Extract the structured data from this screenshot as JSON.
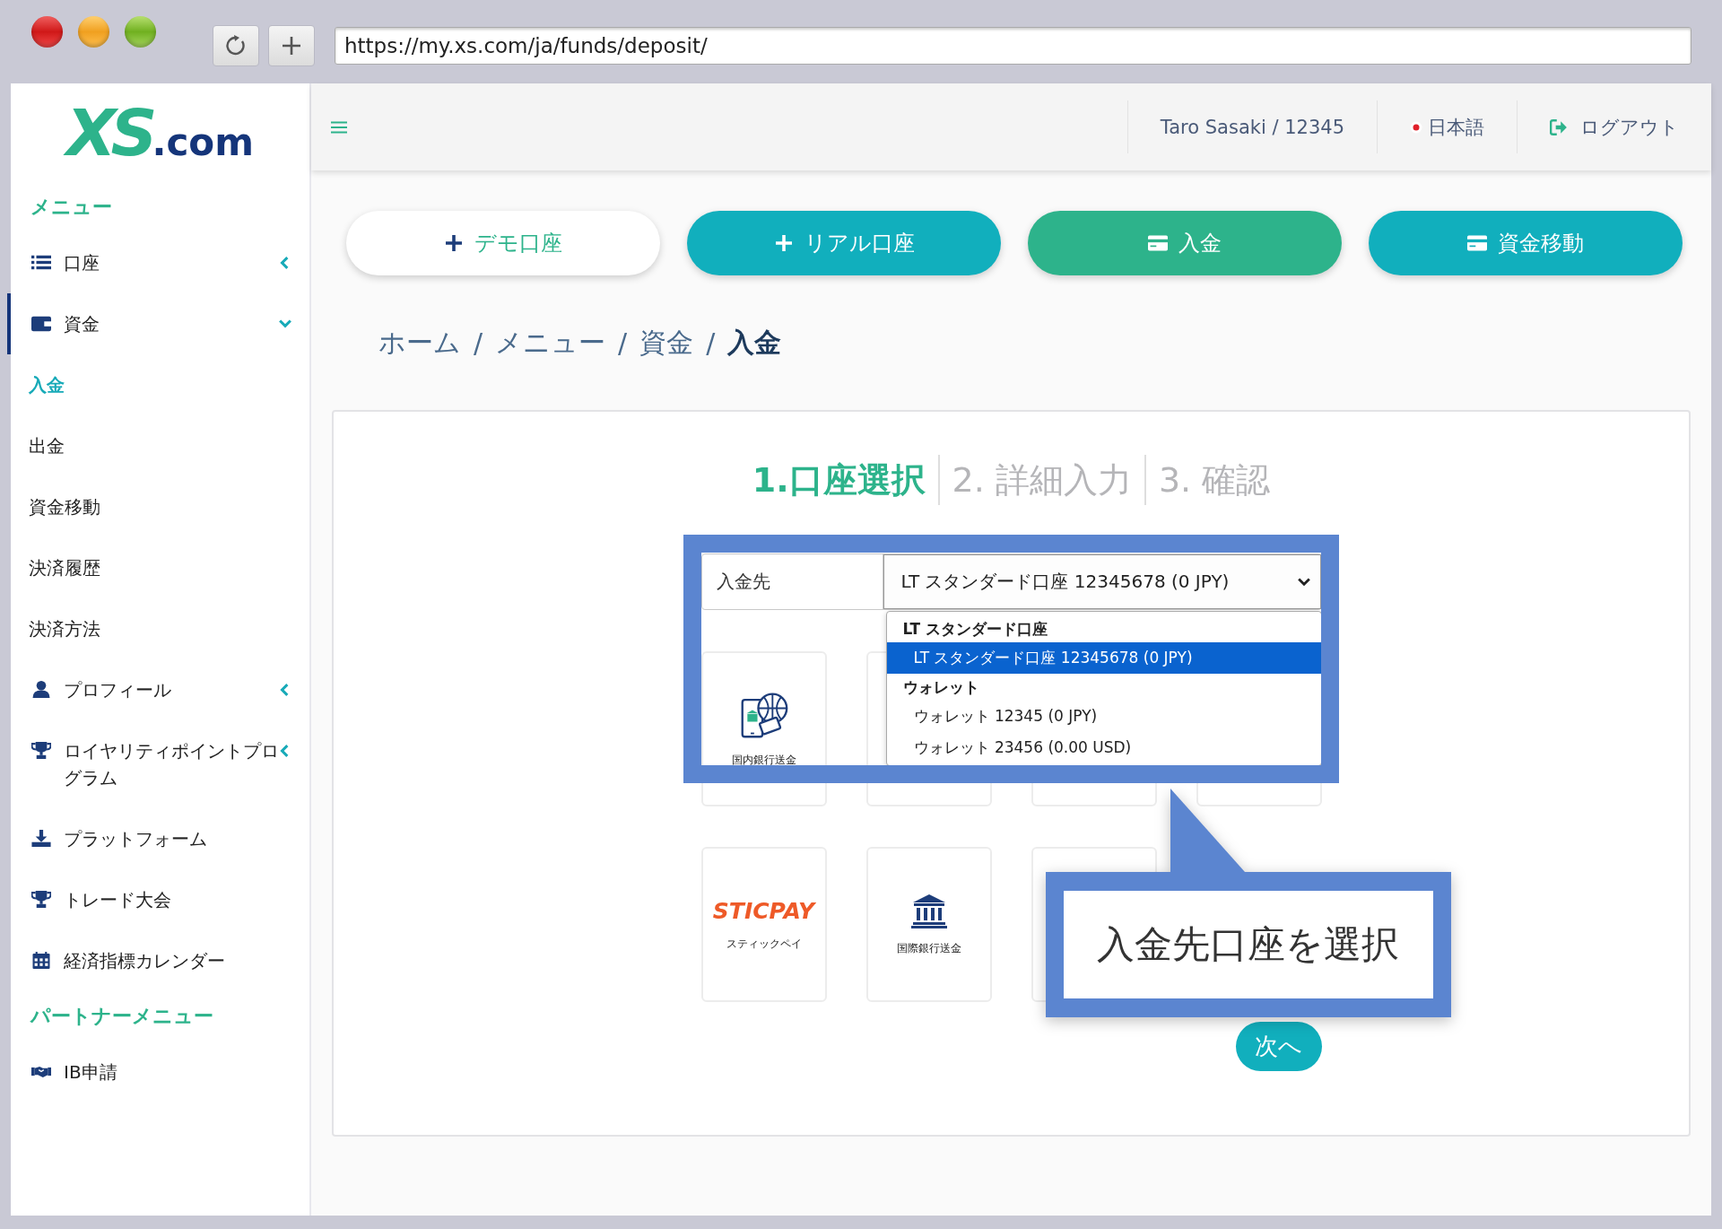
{
  "browser": {
    "url": "https://my.xs.com/ja/funds/deposit/"
  },
  "logo": {
    "mark": "XS",
    "suffix": ".com"
  },
  "sidebar": {
    "items": [
      {
        "kind": "heading",
        "label": "メニュー"
      },
      {
        "kind": "group",
        "label": "口座",
        "expanded": false,
        "selected": false
      },
      {
        "kind": "group",
        "label": "資金",
        "expanded": true,
        "selected": true,
        "children": [
          {
            "label": "入金",
            "selected": true
          },
          {
            "label": "出金",
            "selected": false
          },
          {
            "label": "資金移動",
            "selected": false
          },
          {
            "label": "決済履歴",
            "selected": false
          },
          {
            "label": "決済方法",
            "selected": false
          }
        ]
      },
      {
        "kind": "group",
        "label": "プロフィール",
        "expanded": false,
        "selected": false
      },
      {
        "kind": "group",
        "label": "ロイヤリティポイントプログラム",
        "expanded": false,
        "selected": false
      },
      {
        "kind": "link",
        "label": "プラットフォーム",
        "selected": false
      },
      {
        "kind": "link",
        "label": "トレード大会",
        "selected": false
      },
      {
        "kind": "link",
        "label": "経済指標カレンダー",
        "selected": false
      },
      {
        "kind": "heading",
        "label": "パートナーメニュー"
      },
      {
        "kind": "link",
        "label": "IB申請",
        "selected": false
      }
    ]
  },
  "header": {
    "user": "Taro Sasaki / 12345",
    "language": "日本語",
    "logout": "ログアウト"
  },
  "action_buttons": [
    {
      "label": "デモ口座",
      "kind": "outline"
    },
    {
      "label": "リアル口座",
      "kind": "teal"
    },
    {
      "label": "入金",
      "kind": "green"
    },
    {
      "label": "資金移動",
      "kind": "teal"
    }
  ],
  "breadcrumb": {
    "items": [
      {
        "label": "ホーム",
        "current": false
      },
      {
        "label": "メニュー",
        "current": false
      },
      {
        "label": "資金",
        "current": false
      },
      {
        "label": "入金",
        "current": true
      }
    ],
    "separators": [
      "/",
      "/",
      "/"
    ]
  },
  "steps": [
    {
      "label": "1.口座選択",
      "active": true
    },
    {
      "label": "2. 詳細入力",
      "active": false
    },
    {
      "label": "3. 確認",
      "active": false
    }
  ],
  "deposit_form": {
    "label": "入金先",
    "value": "LT スタンダード口座 12345678 (0 JPY)",
    "expanded": true,
    "groups": [
      {
        "label": "LT スタンダード口座",
        "options": [
          {
            "label": "LT スタンダード口座 12345678 (0 JPY)",
            "selected": true
          }
        ]
      },
      {
        "label": "ウォレット",
        "options": [
          {
            "label": "ウォレット 12345 (0 JPY)",
            "selected": false
          },
          {
            "label": "ウォレット 23456 (0.00 USD)",
            "selected": false
          }
        ]
      }
    ]
  },
  "payment_methods": [
    {
      "kind": "bank-app",
      "label": "国内銀行送金"
    },
    {
      "kind": "blank"
    },
    {
      "kind": "blank"
    },
    {
      "kind": "blank"
    },
    {
      "kind": "sticpay",
      "logo": "STICPAY",
      "label": "スティックペイ"
    },
    {
      "kind": "bank",
      "label": "国際銀行送金"
    },
    {
      "kind": "blank"
    }
  ],
  "next_button": "次へ",
  "callout": {
    "text": "入金先口座を選択"
  }
}
